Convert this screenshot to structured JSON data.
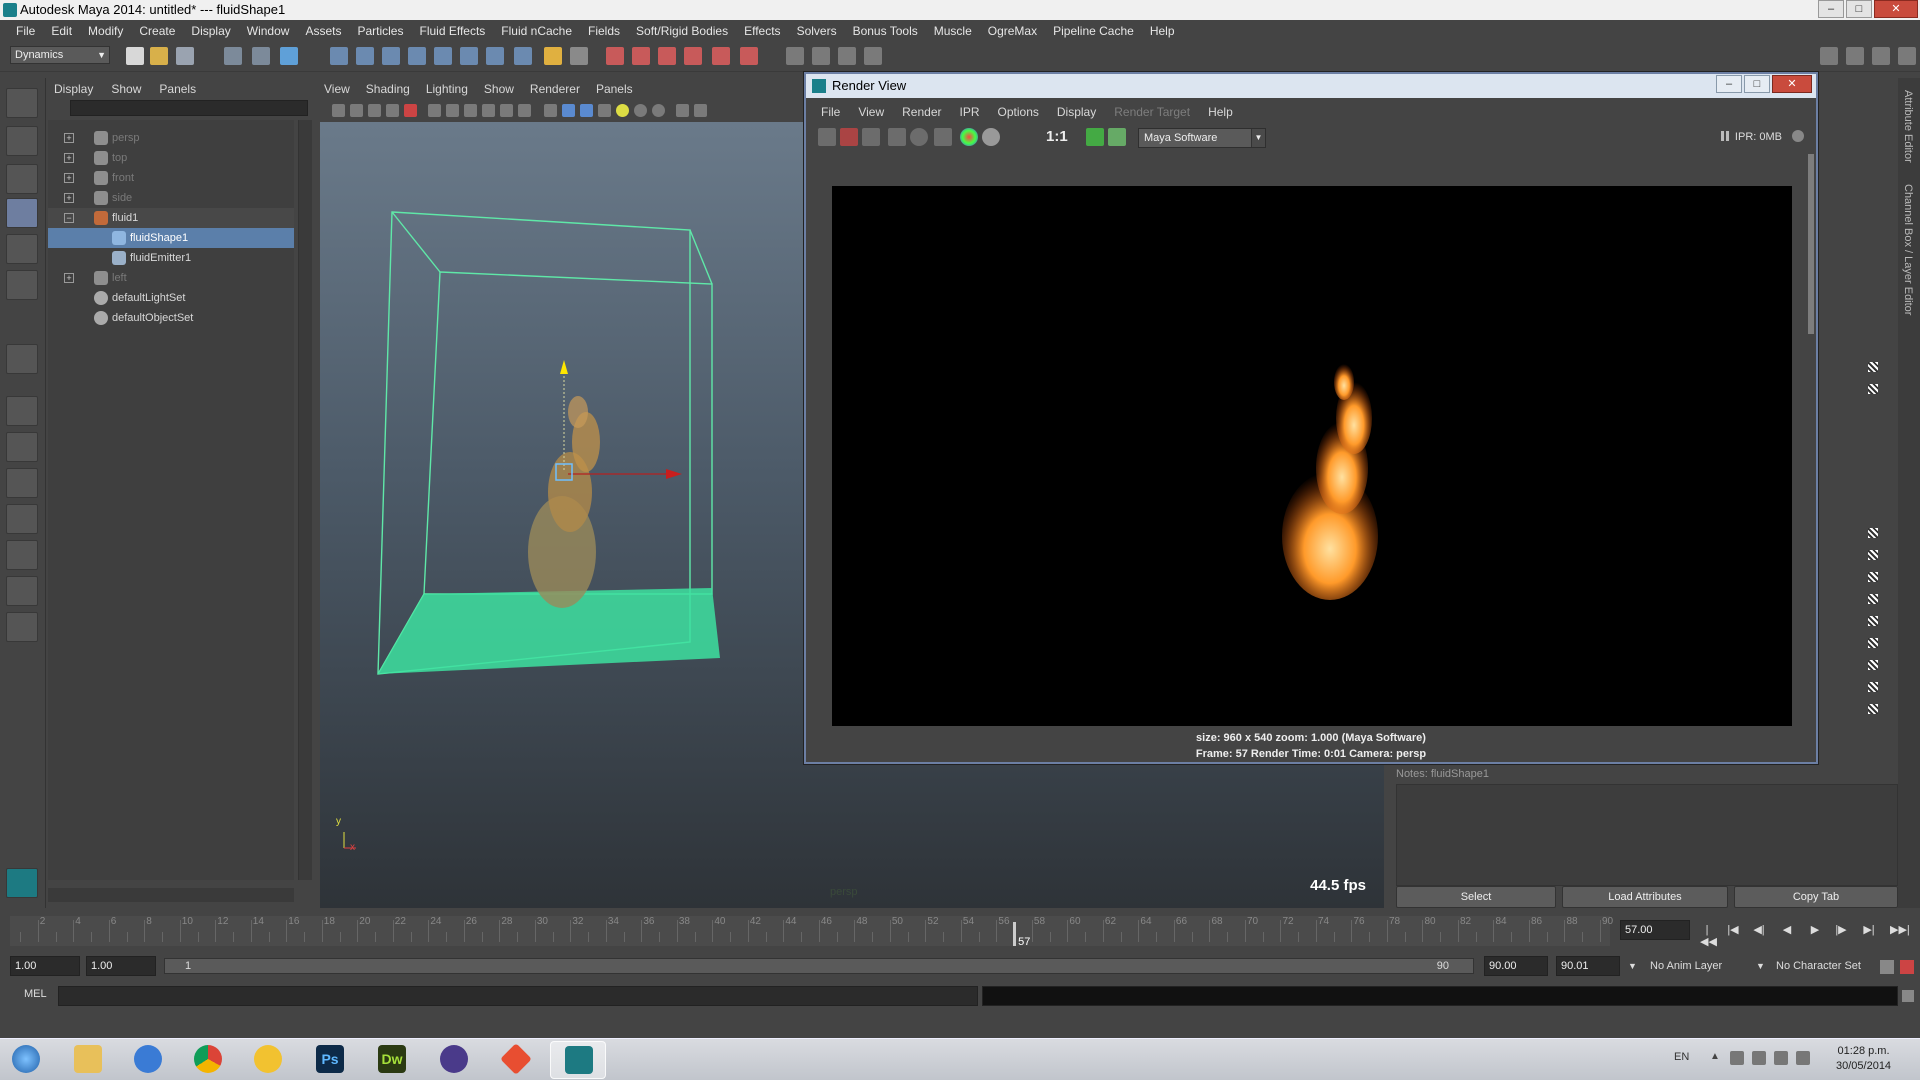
{
  "window": {
    "title": "Autodesk Maya 2014: untitled*   ---   fluidShape1",
    "minimize": "–",
    "maximize": "□",
    "close": "✕"
  },
  "menubar": [
    "File",
    "Edit",
    "Modify",
    "Create",
    "Display",
    "Window",
    "Assets",
    "Particles",
    "Fluid Effects",
    "Fluid nCache",
    "Fields",
    "Soft/Rigid Bodies",
    "Effects",
    "Solvers",
    "Bonus Tools",
    "Muscle",
    "OgreMax",
    "Pipeline Cache",
    "Help"
  ],
  "status": {
    "mode": "Dynamics"
  },
  "outliner": {
    "menu": [
      "Display",
      "Show",
      "Panels"
    ],
    "items": [
      {
        "label": "persp",
        "expand": "+",
        "dim": true
      },
      {
        "label": "top",
        "expand": "+",
        "dim": true
      },
      {
        "label": "front",
        "expand": "+",
        "dim": true
      },
      {
        "label": "side",
        "expand": "+",
        "dim": true
      },
      {
        "label": "fluid1",
        "expand": "−",
        "dim": false
      },
      {
        "label": "fluidShape1",
        "expand": "",
        "dim": false,
        "selected": true
      },
      {
        "label": "fluidEmitter1",
        "expand": "",
        "dim": false
      },
      {
        "label": "left",
        "expand": "+",
        "dim": true
      },
      {
        "label": "defaultLightSet",
        "expand": "",
        "dim": false
      },
      {
        "label": "defaultObjectSet",
        "expand": "",
        "dim": false
      }
    ]
  },
  "viewport": {
    "menu": [
      "View",
      "Shading",
      "Lighting",
      "Show",
      "Renderer",
      "Panels"
    ],
    "fps": "44.5 fps",
    "camera": "persp",
    "axis_y": "y",
    "axis_x": "x"
  },
  "render_view": {
    "title": "Render View",
    "menu": [
      "File",
      "View",
      "Render",
      "IPR",
      "Options",
      "Display",
      "Render Target",
      "Help"
    ],
    "disabled_menu": "Render Target",
    "ratio": "1:1",
    "renderer": "Maya Software",
    "ipr": "IPR: 0MB",
    "info_line1": "size: 960 x 540 zoom: 1.000        (Maya Software)",
    "info_line2": "Frame: 57        Render Time: 0:01        Camera: persp"
  },
  "side_panel": {
    "tab1": "Attribute Editor",
    "tab2": "Channel Box / Layer Editor",
    "notes_label": "Notes:  fluidShape1",
    "buttons": [
      "Select",
      "Load Attributes",
      "Copy Tab"
    ]
  },
  "timeline": {
    "ticks": [
      "2",
      "4",
      "6",
      "8",
      "10",
      "12",
      "14",
      "16",
      "18",
      "20",
      "22",
      "24",
      "26",
      "28",
      "30",
      "32",
      "34",
      "36",
      "38",
      "40",
      "42",
      "44",
      "46",
      "48",
      "50",
      "52",
      "54",
      "56",
      "58",
      "60",
      "62",
      "64",
      "66",
      "68",
      "70",
      "72",
      "74",
      "76",
      "78",
      "80",
      "82",
      "84",
      "86",
      "88",
      "90"
    ],
    "current_frame": "57",
    "current_time": "57.00",
    "playback_icons": [
      "|◀◀",
      "|◀",
      "◀|",
      "◀",
      "▶",
      "|▶",
      "▶|",
      "▶▶|"
    ]
  },
  "range": {
    "start": "1.00",
    "playback_start": "1.00",
    "slider_left": "1",
    "slider_right": "90",
    "playback_end": "90.00",
    "end": "90.01",
    "anim_layer": "No Anim Layer",
    "character_set": "No Character Set"
  },
  "cmdline": {
    "label": "MEL"
  },
  "taskbar": {
    "lang": "EN",
    "time": "01:28 p.m.",
    "date": "30/05/2014",
    "ps_label": "Ps",
    "dw_label": "Dw"
  },
  "colors": {
    "accent": "#5b7faa",
    "fluid_box": "#5fe8a8",
    "flame": "#ff8a1a"
  }
}
